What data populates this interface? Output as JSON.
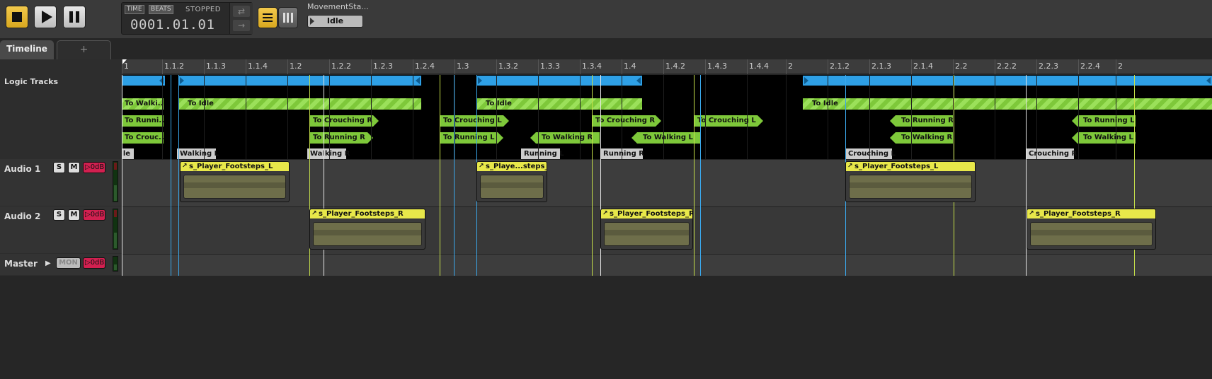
{
  "toolbar": {
    "stop_label": "stop",
    "play_label": "play",
    "pause_label": "pause",
    "mode_time": "TIME",
    "mode_beats": "BEATS",
    "status": "STOPPED",
    "position": "0001.01.01",
    "loop_icon": "⇄",
    "follow_icon": "→",
    "state_machine_name": "MovementSta...",
    "current_state": "Idle",
    "accent_color": "#e0b52a"
  },
  "tabs": {
    "timeline": "Timeline",
    "add": "+"
  },
  "ruler": [
    "1",
    "1.1.2",
    "1.1.3",
    "1.1.4",
    "1.2",
    "1.2.2",
    "1.2.3",
    "1.2.4",
    "1.3",
    "1.3.2",
    "1.3.3",
    "1.3.4",
    "1.4",
    "1.4.2",
    "1.4.3",
    "1.4.4",
    "2",
    "2.1.2",
    "2.1.3",
    "2.1.4",
    "2.2",
    "2.2.2",
    "2.2.3",
    "2.2.4",
    "2"
  ],
  "tracks": {
    "logic_label": "Logic Tracks",
    "audio1": {
      "name": "Audio 1",
      "solo": "S",
      "mute": "M",
      "volume": "▷0dB"
    },
    "audio2": {
      "name": "Audio 2",
      "solo": "S",
      "mute": "M",
      "volume": "▷0dB"
    },
    "master": {
      "name": "Master",
      "mon": "MON",
      "volume": "▷0dB",
      "expand_icon": "▶"
    }
  },
  "transitions": [
    "To Walki...",
    "To Idle",
    "To Idle",
    "To Idle",
    "To Runni...",
    "To Crouching R",
    "To Crouching L",
    "To Crouching R",
    "To Crouching L",
    "To Running R",
    "To Running L",
    "To Crouc...",
    "To Running R",
    "To Running L",
    "To Walking R",
    "To Walking L",
    "To Walking R",
    "To Walking L"
  ],
  "states": [
    "Idle",
    "Walking L",
    "Walking R",
    "Running L",
    "Running R",
    "Crouching L",
    "Crouching R"
  ],
  "clips": [
    "s_Player_Footsteps_L",
    "s_Player_Footsteps_R",
    "s_Playe...steps_L",
    "s_Player_Footsteps_R",
    "s_Player_Footsteps_L",
    "s_Player_Footsteps_R"
  ],
  "colors": {
    "logic_bar": "#2ea0e6",
    "transition": "#7ec83a",
    "clip": "#e8e84a",
    "mute_volume": "#d22050"
  }
}
